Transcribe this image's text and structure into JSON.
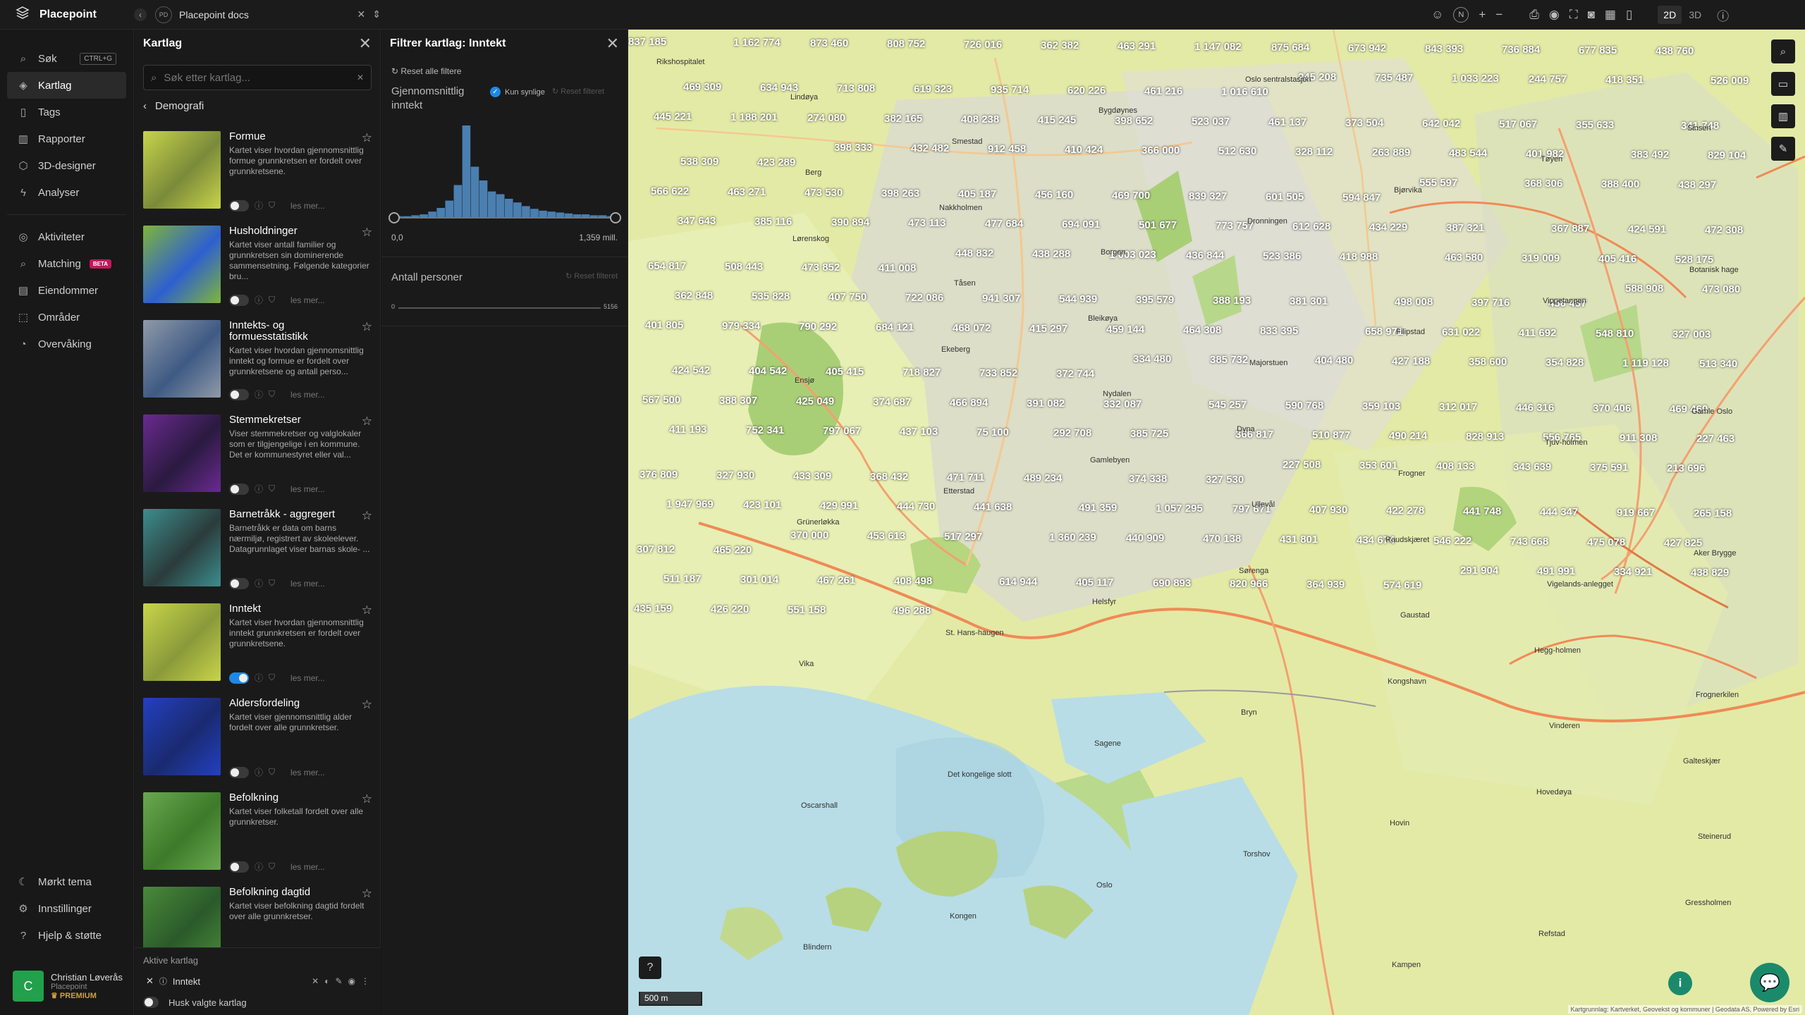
{
  "app": {
    "name": "Placepoint",
    "workspace_avatar": "PD",
    "workspace_name": "Placepoint docs"
  },
  "topbar": {
    "north": "N",
    "mode_2d": "2D",
    "mode_3d": "3D"
  },
  "nav": {
    "search": {
      "label": "Søk",
      "shortcut": "CTRL+G"
    },
    "items_top": [
      "Kartlag",
      "Tags",
      "Rapporter",
      "3D-designer",
      "Analyser"
    ],
    "items_mid": [
      "Aktiviteter",
      "Matching",
      "Eiendommer",
      "Områder",
      "Overvåking"
    ],
    "beta": "BETA",
    "items_bottom": [
      "Mørkt tema",
      "Innstillinger",
      "Hjelp & støtte"
    ]
  },
  "user": {
    "initial": "C",
    "name": "Christian Løverås",
    "org": "Placepoint",
    "tier": "PREMIUM"
  },
  "layers_panel": {
    "title": "Kartlag",
    "search_placeholder": "Søk etter kartlag...",
    "breadcrumb": "Demografi",
    "read_more": "les mer...",
    "items": [
      {
        "name": "Formue",
        "desc": "Kartet viser hvordan gjennomsnittlig formue grunnkretsen er fordelt over grunnkretsene.",
        "on": false,
        "c1": "#c8d44a",
        "c2": "#7a8a3a"
      },
      {
        "name": "Husholdninger",
        "desc": "Kartet viser antall familier og grunnkretsen sin dominerende sammensetning. Følgende kategorier bru...",
        "on": false,
        "c1": "#7fb53a",
        "c2": "#2e5fd0"
      },
      {
        "name": "Inntekts- og formuesstatistikk",
        "desc": "Kartet viser hvordan gjennomsnittlig inntekt og formue er fordelt over grunnkretsene og antall perso...",
        "on": false,
        "c1": "#8f9aa8",
        "c2": "#3e5a84"
      },
      {
        "name": "Stemmekretser",
        "desc": "Viser stemmekretser og valglokaler som er tilgjengelige i en kommune. Det er kommunestyret eller val...",
        "on": false,
        "c1": "#6a2a90",
        "c2": "#2a1a40"
      },
      {
        "name": "Barnetråkk - aggregert",
        "desc": "Barnetråkk er data om barns nærmiljø, registrert av skoleelever. Datagrunnlaget viser barnas skole- ...",
        "on": false,
        "c1": "#3c8e8e",
        "c2": "#2b3b3b"
      },
      {
        "name": "Inntekt",
        "desc": "Kartet viser hvordan gjennomsnittlig inntekt grunnkretsen er fordelt over grunnkretsene.",
        "on": true,
        "c1": "#c8d44a",
        "c2": "#8a9a3a"
      },
      {
        "name": "Aldersfordeling",
        "desc": "Kartet viser gjennomsnittlig alder fordelt over alle grunnkretser.",
        "on": false,
        "c1": "#2340c0",
        "c2": "#1a2a70"
      },
      {
        "name": "Befolkning",
        "desc": "Kartet viser folketall fordelt over alle grunnkretser.",
        "on": false,
        "c1": "#6aa84f",
        "c2": "#3d7a2a"
      },
      {
        "name": "Befolkning dagtid",
        "desc": "Kartet viser befolkning dagtid fordelt over alle grunnkretser.",
        "on": false,
        "c1": "#4a8a3a",
        "c2": "#2a5a2a"
      }
    ]
  },
  "active_layers": {
    "title": "Aktive kartlag",
    "items": [
      "Inntekt"
    ],
    "remember": "Husk valgte kartlag"
  },
  "filter_panel": {
    "title": "Filtrer kartlag: Inntekt",
    "reset_all": "Reset alle filtere",
    "section1": {
      "title": "Gjennomsnittlig inntekt",
      "checkbox_label": "Kun synlige",
      "reset": "Reset filteret",
      "min": "0,0",
      "max": "1,359 mill."
    },
    "section2": {
      "title": "Antall personer",
      "reset": "Reset filteret",
      "min": "0",
      "max": "5156"
    }
  },
  "histogram": {
    "values": [
      1,
      1,
      2,
      3,
      6,
      10,
      18,
      35,
      100,
      55,
      40,
      28,
      25,
      20,
      16,
      12,
      9,
      7,
      6,
      5,
      4,
      3,
      3,
      2,
      2,
      1
    ]
  },
  "map": {
    "scale_label": "500 m",
    "attribution": "Kartgrunnlag: Kartverket, Geovekst og kommuner | Geodata AS, Powered by Esri",
    "places": [
      "Rikshospitalet",
      "Berg",
      "Tåsen",
      "Nydalen",
      "Ullevål",
      "Gaustad",
      "Vinderen",
      "Steinerud",
      "Blindern",
      "Smestad",
      "Borgen",
      "Majorstuen",
      "Frogner",
      "Vigelands-anlegget",
      "Frognerkilen",
      "Oscarshall",
      "Kongen",
      "Bygdøynes",
      "Dronningen",
      "Filipstad",
      "Tjuv-holmen",
      "Aker Brygge",
      "Vika",
      "Det kongelige slott",
      "Oslo",
      "Oslo sentralstasjon",
      "Bjørvika",
      "Vippetangen",
      "Gamle Oslo",
      "Grünerløkka",
      "St. Hans-haugen",
      "Sagene",
      "Torshov",
      "Kampen",
      "Tøyen",
      "Botanisk hage",
      "Ensjø",
      "Etterstad",
      "Helsfyr",
      "Bryn",
      "Hovin",
      "Refstad",
      "Sinsen",
      "Lørenskog",
      "Ekeberg",
      "Gamlebyen",
      "Sørenga",
      "Kongshavn",
      "Hovedøya",
      "Gressholmen",
      "Lindøya",
      "Nakkholmen",
      "Bleikøya",
      "Dyna",
      "Raudskjæret",
      "Hegg-holmen",
      "Galteskjær"
    ],
    "values": [
      {
        "v": "837 185"
      },
      {
        "v": "1 162 774"
      },
      {
        "v": "873 460"
      },
      {
        "v": "808 752"
      },
      {
        "v": "726 016"
      },
      {
        "v": "362 382"
      },
      {
        "v": "463 291"
      },
      {
        "v": "1 147 082"
      },
      {
        "v": "875 684"
      },
      {
        "v": "673 942"
      },
      {
        "v": "843 393"
      },
      {
        "v": "736 884"
      },
      {
        "v": "677 835"
      },
      {
        "v": "438 760"
      },
      {
        "v": "469 309"
      },
      {
        "v": "634 943"
      },
      {
        "v": "713 808"
      },
      {
        "v": "619 323"
      },
      {
        "v": "935 714"
      },
      {
        "v": "620 226"
      },
      {
        "v": "461 216"
      },
      {
        "v": "1 016 610"
      },
      {
        "v": "245 208"
      },
      {
        "v": "735 487"
      },
      {
        "v": "1 033 223"
      },
      {
        "v": "244 757"
      },
      {
        "v": "418 351"
      },
      {
        "v": "526 009"
      },
      {
        "v": "445 221"
      },
      {
        "v": "1 188 201"
      },
      {
        "v": "274 080"
      },
      {
        "v": "382 165"
      },
      {
        "v": "408 238"
      },
      {
        "v": "415 245"
      },
      {
        "v": "398 652"
      },
      {
        "v": "523 037"
      },
      {
        "v": "461 137"
      },
      {
        "v": "373 504"
      },
      {
        "v": "642 042"
      },
      {
        "v": "517 067"
      },
      {
        "v": "355 633"
      },
      {
        "v": "341 748"
      },
      {
        "v": "538 309"
      },
      {
        "v": "423 289"
      },
      {
        "v": "398 333"
      },
      {
        "v": "432 482"
      },
      {
        "v": "912 458"
      },
      {
        "v": "410 424"
      },
      {
        "v": "366 000"
      },
      {
        "v": "512 630"
      },
      {
        "v": "328 112"
      },
      {
        "v": "263 889"
      },
      {
        "v": "483 544"
      },
      {
        "v": "401 982"
      },
      {
        "v": "383 492"
      },
      {
        "v": "829 104"
      },
      {
        "v": "566 622"
      },
      {
        "v": "463 271"
      },
      {
        "v": "473 530"
      },
      {
        "v": "398 263"
      },
      {
        "v": "405 187"
      },
      {
        "v": "456 160"
      },
      {
        "v": "469 700"
      },
      {
        "v": "839 327"
      },
      {
        "v": "601 505"
      },
      {
        "v": "594 847"
      },
      {
        "v": "555 597"
      },
      {
        "v": "368 306"
      },
      {
        "v": "388 400"
      },
      {
        "v": "438 297"
      },
      {
        "v": "347 643"
      },
      {
        "v": "385 116"
      },
      {
        "v": "390 894"
      },
      {
        "v": "473 113"
      },
      {
        "v": "477 684"
      },
      {
        "v": "694 091"
      },
      {
        "v": "501 677"
      },
      {
        "v": "773 757"
      },
      {
        "v": "612 628"
      },
      {
        "v": "434 229"
      },
      {
        "v": "387 321"
      },
      {
        "v": "367 887"
      },
      {
        "v": "424 591"
      },
      {
        "v": "472 308"
      },
      {
        "v": "654 817"
      },
      {
        "v": "508 443"
      },
      {
        "v": "473 852"
      },
      {
        "v": "411 008"
      },
      {
        "v": "448 832"
      },
      {
        "v": "438 288"
      },
      {
        "v": "1 003 023"
      },
      {
        "v": "436 844"
      },
      {
        "v": "523 386"
      },
      {
        "v": "418 988"
      },
      {
        "v": "463 580"
      },
      {
        "v": "319 009"
      },
      {
        "v": "405 416"
      },
      {
        "v": "528 175"
      },
      {
        "v": "362 848"
      },
      {
        "v": "535 828"
      },
      {
        "v": "407 750"
      },
      {
        "v": "722 086"
      },
      {
        "v": "941 307"
      },
      {
        "v": "544 939"
      },
      {
        "v": "395 579"
      },
      {
        "v": "388 193"
      },
      {
        "v": "381 301"
      },
      {
        "v": "498 008"
      },
      {
        "v": "397 716"
      },
      {
        "v": "456 467"
      },
      {
        "v": "588 908"
      },
      {
        "v": "473 080"
      },
      {
        "v": "401 805"
      },
      {
        "v": "979 334"
      },
      {
        "v": "790 292"
      },
      {
        "v": "684 121"
      },
      {
        "v": "468 072"
      },
      {
        "v": "415 297"
      },
      {
        "v": "459 144"
      },
      {
        "v": "464 308"
      },
      {
        "v": "833 395"
      },
      {
        "v": "658 971"
      },
      {
        "v": "631 022"
      },
      {
        "v": "411 692"
      },
      {
        "v": "548 810"
      },
      {
        "v": "327 003"
      },
      {
        "v": "424 542"
      },
      {
        "v": "404 542"
      },
      {
        "v": "405 415"
      },
      {
        "v": "718 827"
      },
      {
        "v": "733 852"
      },
      {
        "v": "372 744"
      },
      {
        "v": "334 480"
      },
      {
        "v": "385 732"
      },
      {
        "v": "404 480"
      },
      {
        "v": "427 188"
      },
      {
        "v": "358 600"
      },
      {
        "v": "354 828"
      },
      {
        "v": "1 119 128"
      },
      {
        "v": "513 340"
      },
      {
        "v": "567 500"
      },
      {
        "v": "388 307"
      },
      {
        "v": "425 049"
      },
      {
        "v": "374 687"
      },
      {
        "v": "466 894"
      },
      {
        "v": "391 082"
      },
      {
        "v": "332 087"
      },
      {
        "v": "545 257"
      },
      {
        "v": "590 768"
      },
      {
        "v": "359 103"
      },
      {
        "v": "312 017"
      },
      {
        "v": "446 316"
      },
      {
        "v": "370 406"
      },
      {
        "v": "469 460"
      },
      {
        "v": "411 193"
      },
      {
        "v": "752 341"
      },
      {
        "v": "797 067"
      },
      {
        "v": "437 103"
      },
      {
        "v": "75 100"
      },
      {
        "v": "292 708"
      },
      {
        "v": "385 725"
      },
      {
        "v": "366 817"
      },
      {
        "v": "510 877"
      },
      {
        "v": "490 214"
      },
      {
        "v": "828 913"
      },
      {
        "v": "556 765"
      },
      {
        "v": "911 308"
      },
      {
        "v": "227 463"
      },
      {
        "v": "376 809"
      },
      {
        "v": "327 930"
      },
      {
        "v": "433 309"
      },
      {
        "v": "368 432"
      },
      {
        "v": "471 711"
      },
      {
        "v": "489 234"
      },
      {
        "v": "374 338"
      },
      {
        "v": "327 530"
      },
      {
        "v": "227 508"
      },
      {
        "v": "353 601"
      },
      {
        "v": "408 133"
      },
      {
        "v": "343 639"
      },
      {
        "v": "375 591"
      },
      {
        "v": "213 696"
      },
      {
        "v": "1 947 969"
      },
      {
        "v": "423 101"
      },
      {
        "v": "429 991"
      },
      {
        "v": "444 730"
      },
      {
        "v": "441 638"
      },
      {
        "v": "491 359"
      },
      {
        "v": "1 057 295"
      },
      {
        "v": "797 671"
      },
      {
        "v": "407 930"
      },
      {
        "v": "422 278"
      },
      {
        "v": "441 748"
      },
      {
        "v": "444 347"
      },
      {
        "v": "919 667"
      },
      {
        "v": "265 158"
      },
      {
        "v": "307 812"
      },
      {
        "v": "465 220"
      },
      {
        "v": "370 000"
      },
      {
        "v": "453 613"
      },
      {
        "v": "517 297"
      },
      {
        "v": "1 360 239"
      },
      {
        "v": "440 909"
      },
      {
        "v": "470 138"
      },
      {
        "v": "431 801"
      },
      {
        "v": "434 674"
      },
      {
        "v": "546 222"
      },
      {
        "v": "743 668"
      },
      {
        "v": "475 078"
      },
      {
        "v": "427 825"
      },
      {
        "v": "511 187"
      },
      {
        "v": "301 014"
      },
      {
        "v": "467 261"
      },
      {
        "v": "408 498"
      },
      {
        "v": "614 944"
      },
      {
        "v": "405 117"
      },
      {
        "v": "690 893"
      },
      {
        "v": "820 966"
      },
      {
        "v": "364 939"
      },
      {
        "v": "574 619"
      },
      {
        "v": "291 904"
      },
      {
        "v": "491 991"
      },
      {
        "v": "334 921"
      },
      {
        "v": "438 829"
      },
      {
        "v": "435 159"
      },
      {
        "v": "426 220"
      },
      {
        "v": "551 158"
      },
      {
        "v": "496 288"
      }
    ]
  }
}
